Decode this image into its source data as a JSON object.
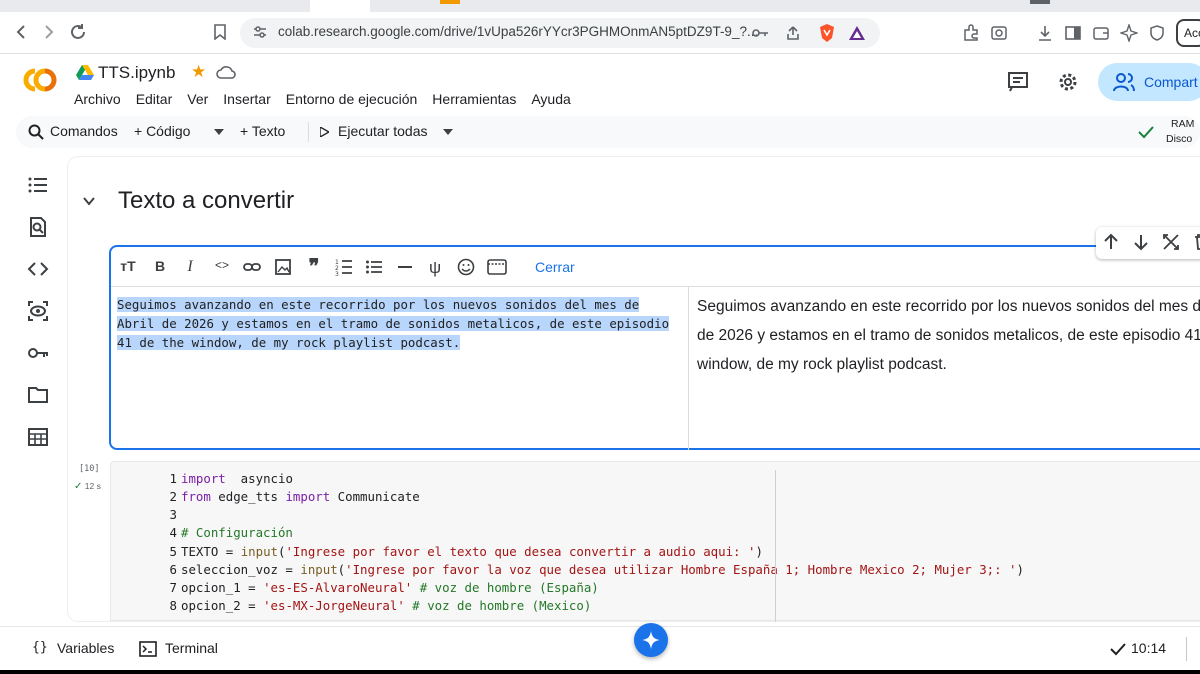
{
  "browser": {
    "url": "colab.research.google.com/drive/1vUpa526rYYcr3PGHMOnmAN5ptDZ9T-9_?...",
    "account_label": "Acc",
    "brave_badge": "4"
  },
  "header": {
    "notebook_title": "TTS.ipynb",
    "share_label": "Compart",
    "menu": [
      "Archivo",
      "Editar",
      "Ver",
      "Insertar",
      "Entorno de ejecución",
      "Herramientas",
      "Ayuda"
    ]
  },
  "toolbar": {
    "commands": "Comandos",
    "code": "+ Código",
    "text": "+ Texto",
    "run_all": "Ejecutar todas",
    "ram": "RAM",
    "disk": "Disco"
  },
  "section": {
    "title": "Texto a convertir"
  },
  "text_cell": {
    "close_label": "Cerrar",
    "editor_lines": [
      "Seguimos avanzando en este recorrido por los nuevos sonidos del mes de",
      "Abril de 2026 y estamos en el tramo de sonidos metalicos, de este episodio",
      "41 de the window, de my rock playlist podcast."
    ],
    "preview_lines": [
      "Seguimos avanzando en este recorrido por los nuevos sonidos del mes de",
      "de 2026 y estamos en el tramo de sonidos metalicos, de este episodio 41",
      "window, de my rock playlist podcast."
    ]
  },
  "code_cell": {
    "execution_count": "[10]",
    "exec_time": "12 s",
    "lines": [
      {
        "n": "1",
        "parts": [
          [
            "kw",
            "import"
          ],
          [
            "",
            "  asyncio"
          ]
        ]
      },
      {
        "n": "2",
        "parts": [
          [
            "kw",
            "from"
          ],
          [
            "",
            " edge_tts "
          ],
          [
            "kw",
            "import"
          ],
          [
            "",
            " Communicate"
          ]
        ]
      },
      {
        "n": "3",
        "parts": []
      },
      {
        "n": "4",
        "parts": [
          [
            "cm",
            "# Configuración"
          ]
        ]
      },
      {
        "n": "5",
        "parts": [
          [
            "",
            "TEXTO = "
          ],
          [
            "fn",
            "input"
          ],
          [
            "",
            "("
          ],
          [
            "str",
            "'Ingrese por favor el texto que desea convertir a audio aqui: '"
          ],
          [
            "",
            ")"
          ]
        ]
      },
      {
        "n": "6",
        "parts": [
          [
            "",
            "seleccion_voz = "
          ],
          [
            "fn",
            "input"
          ],
          [
            "",
            "("
          ],
          [
            "str",
            "'Ingrese por favor la voz que desea utilizar Hombre España 1; Hombre Mexico 2; Mujer 3;: '"
          ],
          [
            "",
            ")"
          ]
        ]
      },
      {
        "n": "7",
        "parts": [
          [
            "",
            "opcion_1 = "
          ],
          [
            "str",
            "'es-ES-AlvaroNeural'"
          ],
          [
            "",
            " "
          ],
          [
            "cm",
            "# voz de hombre (España)"
          ]
        ]
      },
      {
        "n": "8",
        "parts": [
          [
            "",
            "opcion_2 = "
          ],
          [
            "str",
            "'es-MX-JorgeNeural'"
          ],
          [
            "",
            " "
          ],
          [
            "cm",
            "# voz de hombre (Mexico)"
          ]
        ]
      }
    ]
  },
  "bottom": {
    "variables": "Variables",
    "terminal": "Terminal",
    "time": "10:14"
  }
}
